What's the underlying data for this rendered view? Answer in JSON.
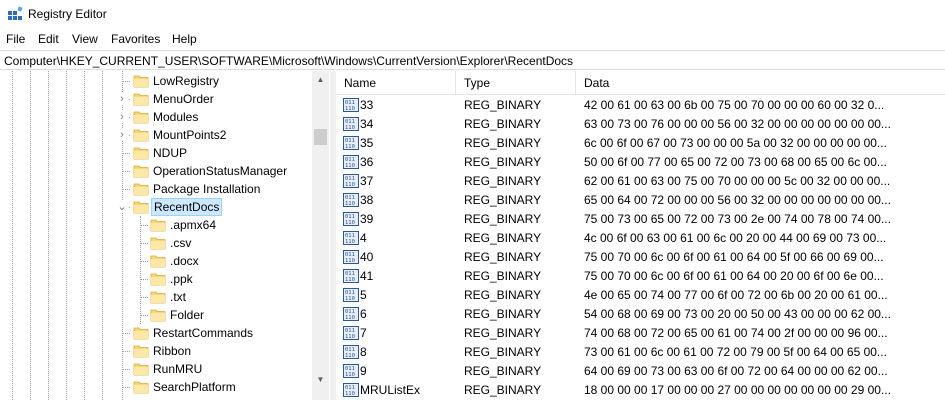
{
  "window": {
    "title": "Registry Editor",
    "icon": "registry-editor-icon"
  },
  "menu": [
    "File",
    "Edit",
    "View",
    "Favorites",
    "Help"
  ],
  "address": "Computer\\HKEY_CURRENT_USER\\SOFTWARE\\Microsoft\\Windows\\CurrentVersion\\Explorer\\RecentDocs",
  "tree": {
    "items": [
      {
        "label": "LowRegistry",
        "expandable": false,
        "selected": false,
        "child": false
      },
      {
        "label": "MenuOrder",
        "expandable": true,
        "selected": false,
        "child": false
      },
      {
        "label": "Modules",
        "expandable": true,
        "selected": false,
        "child": false
      },
      {
        "label": "MountPoints2",
        "expandable": true,
        "selected": false,
        "child": false
      },
      {
        "label": "NDUP",
        "expandable": false,
        "selected": false,
        "child": false
      },
      {
        "label": "OperationStatusManager",
        "expandable": false,
        "selected": false,
        "child": false
      },
      {
        "label": "Package Installation",
        "expandable": false,
        "selected": false,
        "child": false
      },
      {
        "label": "RecentDocs",
        "expandable": true,
        "expanded": true,
        "selected": true,
        "child": false
      },
      {
        "label": ".apmx64",
        "expandable": false,
        "selected": false,
        "child": true
      },
      {
        "label": ".csv",
        "expandable": false,
        "selected": false,
        "child": true
      },
      {
        "label": ".docx",
        "expandable": false,
        "selected": false,
        "child": true
      },
      {
        "label": ".ppk",
        "expandable": false,
        "selected": false,
        "child": true
      },
      {
        "label": ".txt",
        "expandable": false,
        "selected": false,
        "child": true
      },
      {
        "label": "Folder",
        "expandable": false,
        "selected": false,
        "child": true
      },
      {
        "label": "RestartCommands",
        "expandable": false,
        "selected": false,
        "child": false
      },
      {
        "label": "Ribbon",
        "expandable": false,
        "selected": false,
        "child": false
      },
      {
        "label": "RunMRU",
        "expandable": false,
        "selected": false,
        "child": false
      },
      {
        "label": "SearchPlatform",
        "expandable": false,
        "selected": false,
        "child": false
      }
    ]
  },
  "list": {
    "columns": [
      "Name",
      "Type",
      "Data"
    ],
    "rows": [
      {
        "name": "33",
        "type": "REG_BINARY",
        "data": "42 00 61 00 63 00 6b 00 75 00 70 00 00 00 60 00 32 0..."
      },
      {
        "name": "34",
        "type": "REG_BINARY",
        "data": "63 00 73 00 76 00 00 00 56 00 32 00 00 00 00 00 00 00..."
      },
      {
        "name": "35",
        "type": "REG_BINARY",
        "data": "6c 00 6f 00 67 00 73 00 00 00 5a 00 32 00 00 00 00 00..."
      },
      {
        "name": "36",
        "type": "REG_BINARY",
        "data": "50 00 6f 00 77 00 65 00 72 00 73 00 68 00 65 00 6c 00..."
      },
      {
        "name": "37",
        "type": "REG_BINARY",
        "data": "62 00 61 00 63 00 75 00 70 00 00 00 5c 00 32 00 00 00..."
      },
      {
        "name": "38",
        "type": "REG_BINARY",
        "data": "65 00 64 00 72 00 00 00 56 00 32 00 00 00 00 00 00 00..."
      },
      {
        "name": "39",
        "type": "REG_BINARY",
        "data": "75 00 73 00 65 00 72 00 73 00 2e 00 74 00 78 00 74 00..."
      },
      {
        "name": "4",
        "type": "REG_BINARY",
        "data": "4c 00 6f 00 63 00 61 00 6c 00 20 00 44 00 69 00 73 00..."
      },
      {
        "name": "40",
        "type": "REG_BINARY",
        "data": "75 00 70 00 6c 00 6f 00 61 00 64 00 5f 00 66 00 69 00..."
      },
      {
        "name": "41",
        "type": "REG_BINARY",
        "data": "75 00 70 00 6c 00 6f 00 61 00 64 00 20 00 6f 00 6e 00..."
      },
      {
        "name": "5",
        "type": "REG_BINARY",
        "data": "4e 00 65 00 74 00 77 00 6f 00 72 00 6b 00 20 00 61 00..."
      },
      {
        "name": "6",
        "type": "REG_BINARY",
        "data": "54 00 68 00 69 00 73 00 20 00 50 00 43 00 00 00 62 00..."
      },
      {
        "name": "7",
        "type": "REG_BINARY",
        "data": "74 00 68 00 72 00 65 00 61 00 74 00 2f 00 00 00 96 00..."
      },
      {
        "name": "8",
        "type": "REG_BINARY",
        "data": "73 00 61 00 6c 00 61 00 72 00 79 00 5f 00 64 00 65 00..."
      },
      {
        "name": "9",
        "type": "REG_BINARY",
        "data": "64 00 69 00 73 00 63 00 6f 00 72 00 64 00 00 00 62 00..."
      },
      {
        "name": "MRUListEx",
        "type": "REG_BINARY",
        "data": "18 00 00 00 17 00 00 00 27 00 00 00 00 00 00 00 29 00..."
      }
    ]
  },
  "colors": {
    "selection_bg": "#cce8ff",
    "selection_border": "#99d1ff",
    "folder_yellow": "#f8d775",
    "binary_icon_blue": "#2b5797"
  },
  "icons": {
    "folder": "folder-icon",
    "binary_value": "reg-binary-icon",
    "expand": "chevron-right-icon",
    "collapse": "chevron-down-icon"
  }
}
